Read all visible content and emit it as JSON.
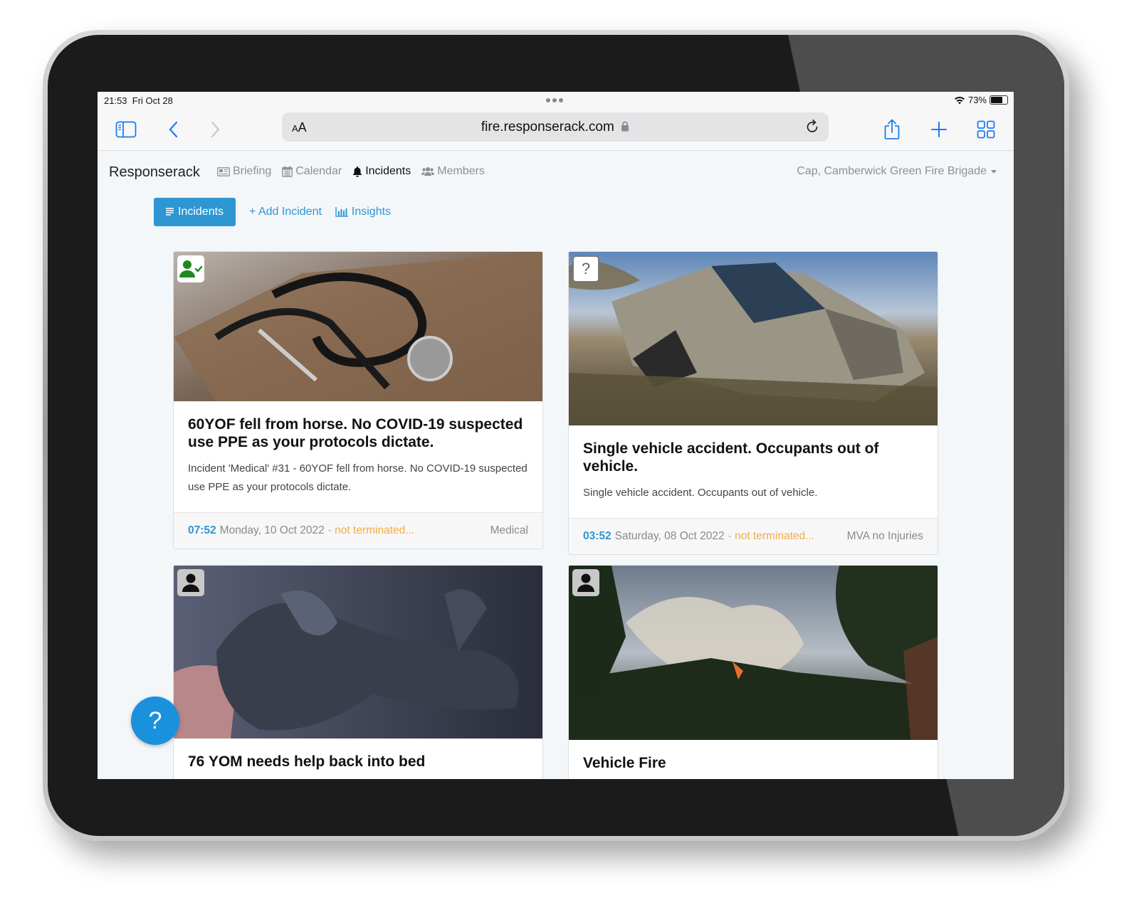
{
  "status_bar": {
    "time": "21:53",
    "date": "Fri Oct 28",
    "battery": "73%"
  },
  "browser": {
    "url": "fire.responserack.com",
    "text_size_label_small": "A",
    "text_size_label_large": "A"
  },
  "nav": {
    "brand": "Responserack",
    "links": [
      {
        "label": "Briefing",
        "icon": "newspaper-icon"
      },
      {
        "label": "Calendar",
        "icon": "calendar-icon"
      },
      {
        "label": "Incidents",
        "icon": "bell-icon",
        "active": true
      },
      {
        "label": "Members",
        "icon": "users-icon"
      }
    ],
    "user_menu": "Cap, Camberwick Green Fire Brigade"
  },
  "subnav": {
    "incidents_label": "Incidents",
    "add_incident_label": "+ Add Incident",
    "insights_label": "Insights"
  },
  "colors": {
    "accent": "#2d96d3",
    "warning": "#f0ad4e",
    "attending": "#1e8a1e"
  },
  "incidents": [
    {
      "badge": "attending",
      "image": "stethoscope",
      "title": "60YOF fell from horse. No COVID-19 suspected use PPE as your protocols dictate.",
      "description": "Incident 'Medical' #31 - 60YOF fell from horse. No COVID-19 suspected use PPE as your protocols dictate.",
      "time": "07:52",
      "date": "Monday, 10 Oct 2022",
      "status": "- not terminated...",
      "type": "Medical"
    },
    {
      "badge": "unknown",
      "badge_text": "?",
      "image": "crashed-vehicle",
      "title": "Single vehicle accident. Occupants out of vehicle.",
      "description": "Single vehicle accident. Occupants out of vehicle.",
      "time": "03:52",
      "date": "Saturday, 08 Oct 2022",
      "status": "- not terminated...",
      "type": "MVA no Injuries"
    },
    {
      "badge": "person",
      "image": "gloved-hand",
      "title": "76 YOM needs help back into bed"
    },
    {
      "badge": "person",
      "image": "wildfire",
      "title": "Vehicle Fire"
    }
  ],
  "help_button": "?"
}
